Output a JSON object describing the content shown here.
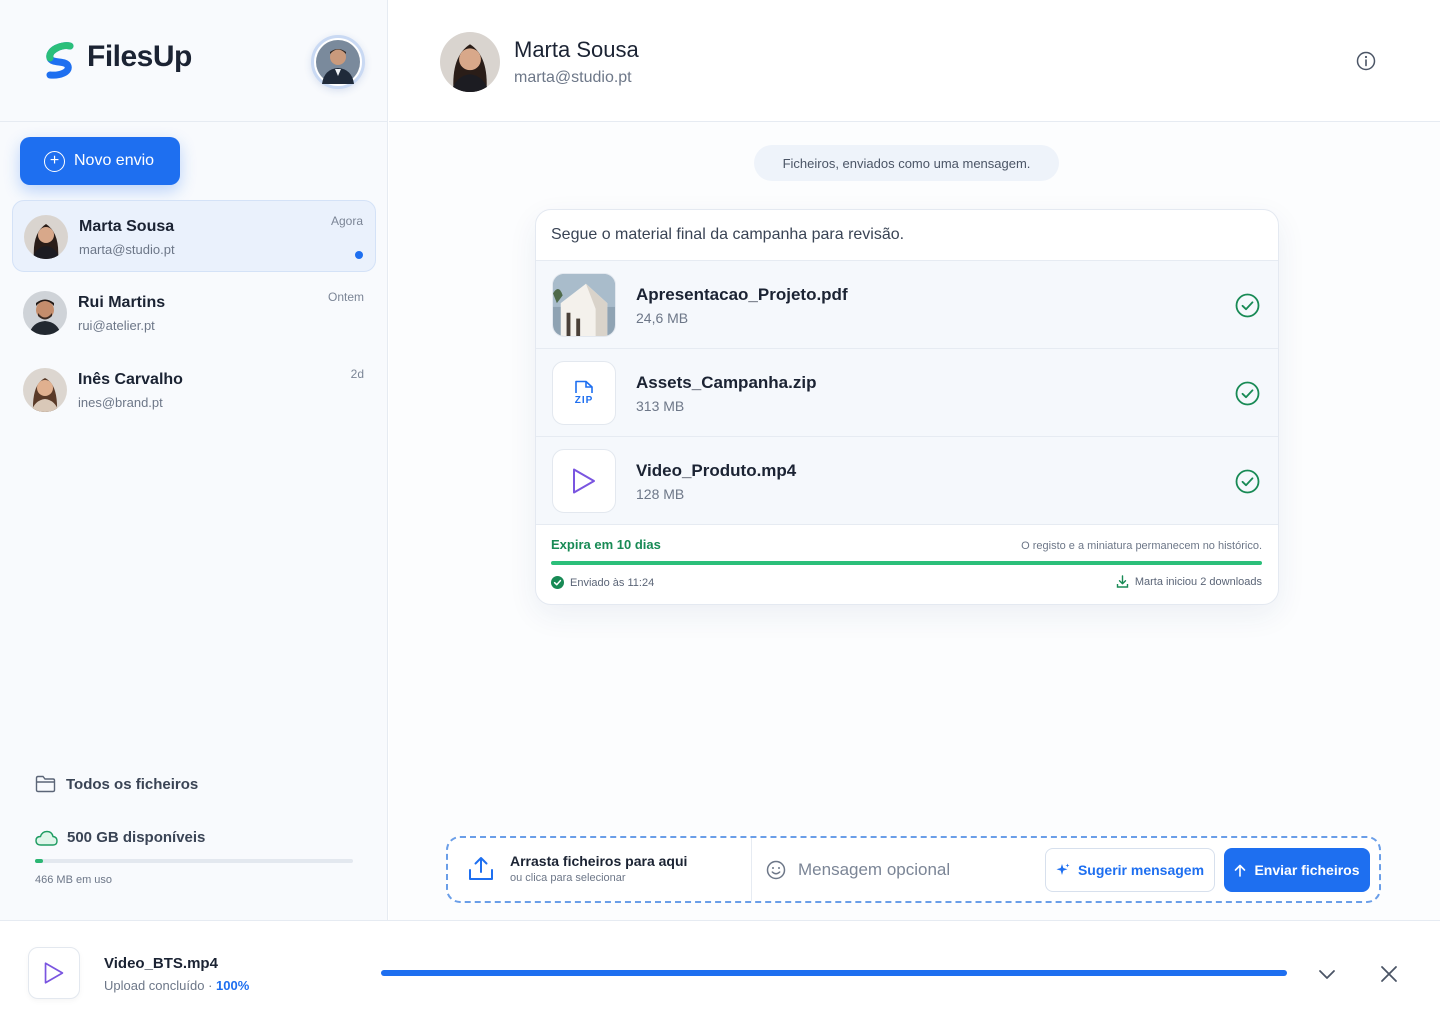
{
  "brand": {
    "name": "FilesUp"
  },
  "sidebar": {
    "new_button_label": "Novo envio",
    "conversations": [
      {
        "name": "Marta Sousa",
        "email": "marta@studio.pt",
        "time": "Agora",
        "unread": true
      },
      {
        "name": "Rui Martins",
        "email": "rui@atelier.pt",
        "time": "Ontem",
        "unread": false
      },
      {
        "name": "Inês Carvalho",
        "email": "ines@brand.pt",
        "time": "2d",
        "unread": false
      }
    ],
    "all_files_label": "Todos os ficheiros",
    "storage_label": "500 GB disponíveis",
    "storage_used_label": "466 MB em uso",
    "storage_used_fraction": 0.025
  },
  "header": {
    "name": "Marta Sousa",
    "email": "marta@studio.pt"
  },
  "thread": {
    "pill_text": "Ficheiros, enviados como uma mensagem.",
    "message": "Segue o material final da campanha para revisão.",
    "files": [
      {
        "name": "Apresentacao_Projeto.pdf",
        "size": "24,6 MB",
        "icon": "image-thumbnail"
      },
      {
        "name": "Assets_Campanha.zip",
        "size": "313 MB",
        "icon": "zip-icon",
        "icon_text": "ZIP"
      },
      {
        "name": "Video_Produto.mp4",
        "size": "128 MB",
        "icon": "play-icon"
      }
    ],
    "expire_label": "Expira em 10 dias",
    "history_note": "O registo e a miniatura permanecem no histórico.",
    "sent_label": "Enviado às 11:24",
    "downloads_label": "Marta iniciou 2 downloads"
  },
  "composer": {
    "drop_title": "Arrasta ficheiros para aqui",
    "drop_subtitle": "ou clica para selecionar",
    "message_placeholder": "Mensagem opcional",
    "suggest_label": "Sugerir mensagem",
    "send_label": "Enviar ficheiros"
  },
  "upload": {
    "file_name": "Video_BTS.mp4",
    "status_prefix": "Upload concluído · ",
    "percent_label": "100%",
    "progress_fraction": 1.0
  },
  "colors": {
    "accent": "#1e6ff0",
    "success": "#2bbf7a",
    "ok_text": "#188a55"
  }
}
